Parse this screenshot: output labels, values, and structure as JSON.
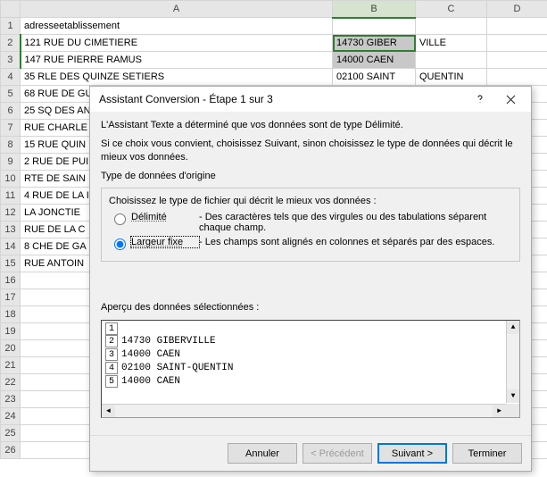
{
  "sheet": {
    "columns": [
      "A",
      "B",
      "C",
      "D"
    ],
    "rows": [
      {
        "n": "1",
        "a": "adresseetablissement",
        "b": "",
        "c": ""
      },
      {
        "n": "2",
        "a": "121 RUE DU CIMETIERE",
        "b": "14730 GIBER",
        "c": "VILLE"
      },
      {
        "n": "3",
        "a": "147 RUE PIERRE RAMUS",
        "b": "14000 CAEN",
        "c": ""
      },
      {
        "n": "4",
        "a": "35 RLE DES QUINZE SETIERS",
        "b": "02100 SAINT",
        "c": "QUENTIN"
      },
      {
        "n": "5",
        "a": "68 RUE DE GU",
        "b": "",
        "c": ""
      },
      {
        "n": "6",
        "a": "25 SQ DES AN",
        "b": "",
        "c": ""
      },
      {
        "n": "7",
        "a": " RUE CHARLE",
        "b": "",
        "c": ""
      },
      {
        "n": "8",
        "a": "15 RUE QUIN",
        "b": "",
        "c": ""
      },
      {
        "n": "9",
        "a": "2 RUE DE PUI",
        "b": "",
        "c": ""
      },
      {
        "n": "10",
        "a": "RTE DE SAIN",
        "b": "",
        "c": ""
      },
      {
        "n": "11",
        "a": "4 RUE DE LA I",
        "b": "",
        "c": ""
      },
      {
        "n": "12",
        "a": " LA JONCTIE",
        "b": "",
        "c": ""
      },
      {
        "n": "13",
        "a": " RUE DE LA C",
        "b": "",
        "c": ""
      },
      {
        "n": "14",
        "a": "8 CHE DE GA",
        "b": "",
        "c": ""
      },
      {
        "n": "15",
        "a": " RUE ANTOIN",
        "b": "",
        "c": ""
      },
      {
        "n": "16",
        "a": "",
        "b": "",
        "c": ""
      },
      {
        "n": "17",
        "a": "",
        "b": "",
        "c": ""
      },
      {
        "n": "18",
        "a": "",
        "b": "",
        "c": ""
      },
      {
        "n": "19",
        "a": "",
        "b": "",
        "c": ""
      },
      {
        "n": "20",
        "a": "",
        "b": "",
        "c": ""
      },
      {
        "n": "21",
        "a": "",
        "b": "",
        "c": ""
      },
      {
        "n": "22",
        "a": "",
        "b": "",
        "c": ""
      },
      {
        "n": "23",
        "a": "",
        "b": "",
        "c": ""
      },
      {
        "n": "24",
        "a": "",
        "b": "",
        "c": ""
      },
      {
        "n": "25",
        "a": "",
        "b": "",
        "c": ""
      },
      {
        "n": "26",
        "a": "",
        "b": "",
        "c": ""
      }
    ]
  },
  "dialog": {
    "title": "Assistant Conversion - Étape 1 sur 3",
    "intro1": "L'Assistant Texte a déterminé que vos données sont de type Délimité.",
    "intro2": "Si ce choix vous convient, choisissez Suivant, sinon choisissez le type de données qui décrit le mieux vos données.",
    "group_label": "Type de données d'origine",
    "group_intro": "Choisissez le type de fichier qui décrit le mieux vos données :",
    "opt_delim_label": "Délimité",
    "opt_delim_desc": "- Des caractères tels que des virgules ou des tabulations séparent chaque champ.",
    "opt_fixed_label": "Largeur fixe",
    "opt_fixed_desc": "- Les champs sont alignés en colonnes et séparés par des espaces.",
    "preview_label": "Aperçu des données sélectionnées :",
    "preview": [
      {
        "n": "1",
        "t": ""
      },
      {
        "n": "2",
        "t": "14730 GIBERVILLE"
      },
      {
        "n": "3",
        "t": "14000 CAEN"
      },
      {
        "n": "4",
        "t": "02100 SAINT-QUENTIN"
      },
      {
        "n": "5",
        "t": "14000 CAEN"
      }
    ],
    "buttons": {
      "cancel": "Annuler",
      "prev": "< Précédent",
      "next": "Suivant >",
      "finish": "Terminer"
    }
  }
}
